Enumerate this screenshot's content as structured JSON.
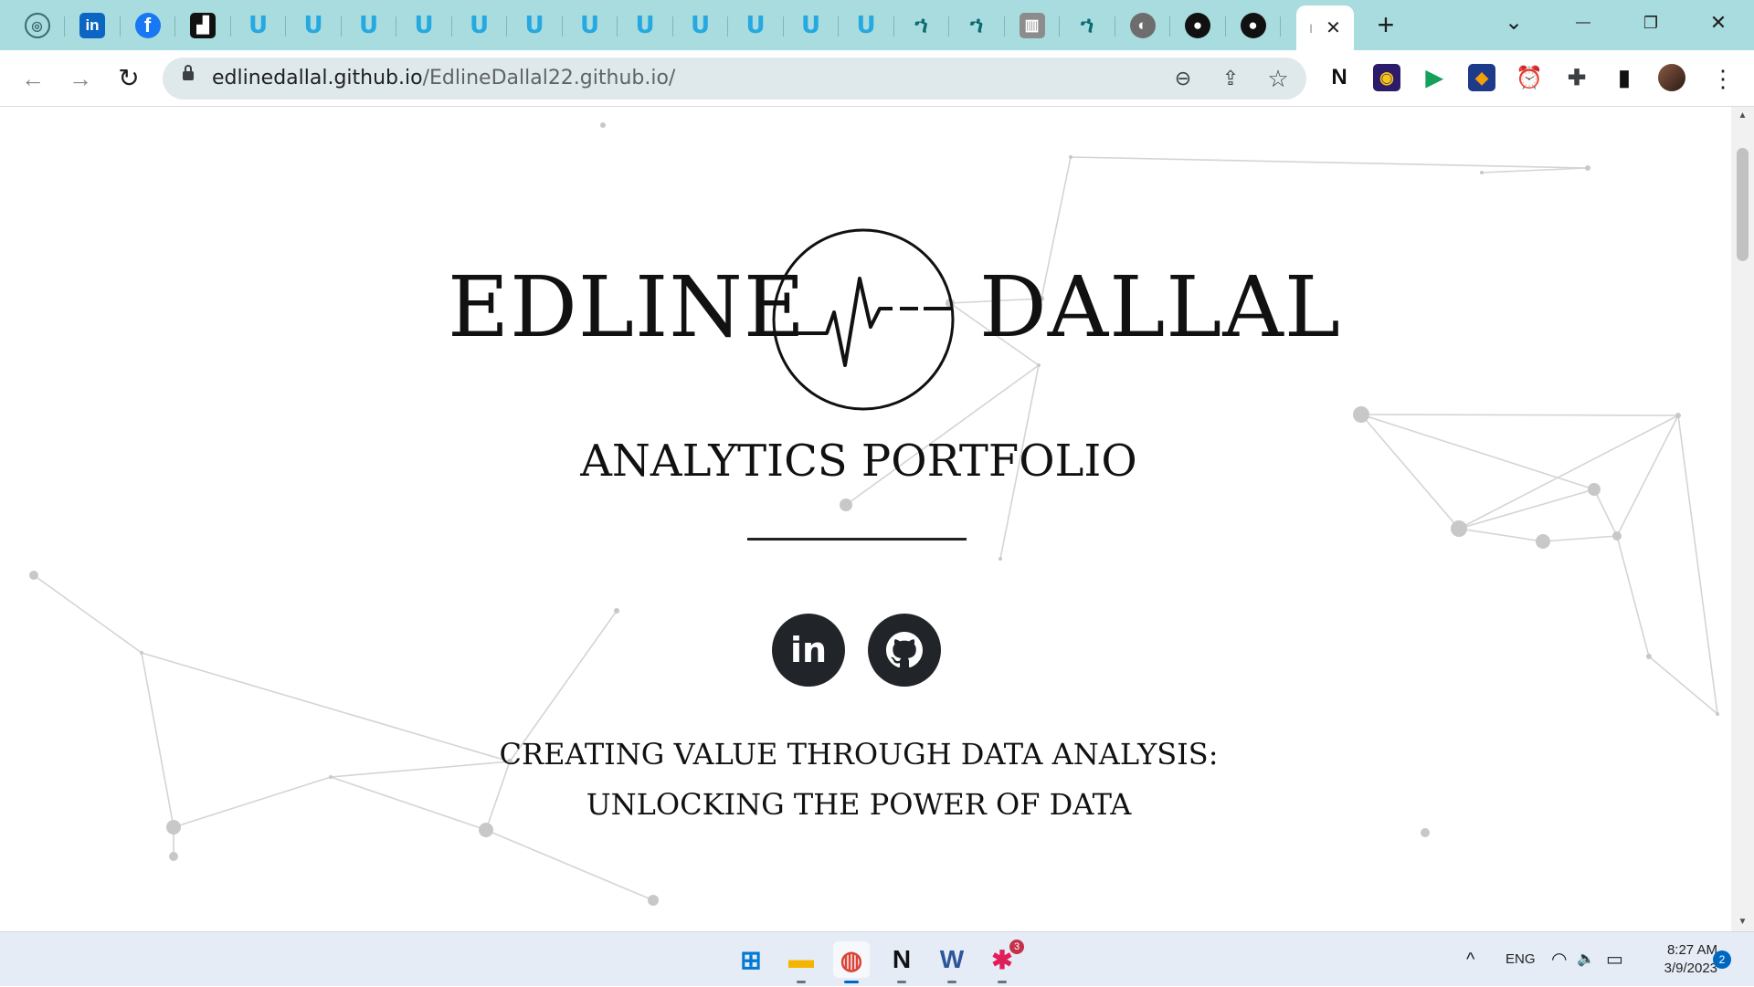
{
  "browser": {
    "tabs": [
      {
        "icon": "chatgpt-icon",
        "glyph": "◎"
      },
      {
        "icon": "linkedin-icon",
        "glyph": "in"
      },
      {
        "icon": "facebook-icon",
        "glyph": "f"
      },
      {
        "icon": "dark-app-icon",
        "glyph": "▟"
      },
      {
        "icon": "udacity-icon",
        "glyph": "U"
      },
      {
        "icon": "udacity-icon",
        "glyph": "U"
      },
      {
        "icon": "udacity-icon",
        "glyph": "U"
      },
      {
        "icon": "udacity-icon",
        "glyph": "U"
      },
      {
        "icon": "udacity-icon",
        "glyph": "U"
      },
      {
        "icon": "udacity-icon",
        "glyph": "U"
      },
      {
        "icon": "udacity-icon",
        "glyph": "U"
      },
      {
        "icon": "udacity-icon",
        "glyph": "U"
      },
      {
        "icon": "udacity-icon",
        "glyph": "U"
      },
      {
        "icon": "udacity-icon",
        "glyph": "U"
      },
      {
        "icon": "udacity-icon",
        "glyph": "U"
      },
      {
        "icon": "udacity-icon",
        "glyph": "U"
      },
      {
        "icon": "bird-icon",
        "glyph": "ኀ"
      },
      {
        "icon": "bird-icon",
        "glyph": "ኀ"
      },
      {
        "icon": "gray-doc-icon",
        "glyph": "▥"
      },
      {
        "icon": "bird-icon",
        "glyph": "ኀ"
      },
      {
        "icon": "globe-icon",
        "glyph": "◐"
      },
      {
        "icon": "github-icon",
        "glyph": "●"
      },
      {
        "icon": "github-icon",
        "glyph": "●"
      }
    ],
    "active_tab": {
      "title": "I",
      "close": "✕"
    },
    "new_tab": "+",
    "window_controls": {
      "dropdown": "⌄",
      "minimize": "—",
      "restore": "❐",
      "close": "✕"
    },
    "nav": {
      "back": "←",
      "forward": "→",
      "reload": "↻"
    },
    "address": {
      "host": "edlinedallal.github.io",
      "path": "/EdlineDallal22.github.io/"
    },
    "omnibox_icons": {
      "zoom": "⊖",
      "share": "⇪",
      "bookmark": "☆"
    },
    "extensions": [
      {
        "name": "notion-extension-icon",
        "glyph": "N",
        "bg": "#ffffff",
        "fg": "#111111"
      },
      {
        "name": "colorful-extension-icon",
        "glyph": "◉",
        "bg": "#2d1b69",
        "fg": "#f5c518"
      },
      {
        "name": "send-extension-icon",
        "glyph": "▶",
        "bg": "#ffffff",
        "fg": "#16a05d"
      },
      {
        "name": "cube-extension-icon",
        "glyph": "◆",
        "bg": "#1e3a8a",
        "fg": "#f59e0b"
      },
      {
        "name": "timer-extension-icon",
        "glyph": "⏰",
        "bg": "#ffffff",
        "fg": "#3b82f6"
      },
      {
        "name": "puzzle-extension-icon",
        "glyph": "✚",
        "bg": "#ffffff",
        "fg": "#3c4043"
      },
      {
        "name": "sidepanel-icon",
        "glyph": "▮",
        "bg": "#ffffff",
        "fg": "#111111"
      }
    ],
    "menu": "⋮"
  },
  "page": {
    "name_first": "EDLINE",
    "name_last": "DALLAL",
    "subtitle": "ANALYTICS PORTFOLIO",
    "social": [
      {
        "name": "linkedin-button",
        "glyph": "in"
      },
      {
        "name": "github-button",
        "glyph": "●"
      }
    ],
    "tagline_line1": "CREATING VALUE THROUGH DATA ANALYSIS:",
    "tagline_line2": "UNLOCKING THE POWER OF DATA"
  },
  "taskbar": {
    "apps": [
      {
        "name": "windows-start-icon",
        "glyph": "⊞",
        "color": "#0078d4",
        "active": false
      },
      {
        "name": "file-explorer-icon",
        "glyph": "▬",
        "color": "#f4b400",
        "active": false
      },
      {
        "name": "chrome-icon",
        "glyph": "◍",
        "color": "#db4437",
        "active": true
      },
      {
        "name": "notion-icon",
        "glyph": "N",
        "color": "#111111",
        "active": false
      },
      {
        "name": "word-icon",
        "glyph": "W",
        "color": "#2b579a",
        "active": false
      },
      {
        "name": "slack-icon",
        "glyph": "✱",
        "color": "#e01e5a",
        "active": false,
        "badge": "3"
      }
    ],
    "tray": {
      "chevron": "^",
      "language": "ENG",
      "wifi": "◠",
      "volume": "🔈",
      "battery": "▭",
      "time": "8:27 AM",
      "date": "3/9/2023",
      "notifications": "2"
    }
  }
}
